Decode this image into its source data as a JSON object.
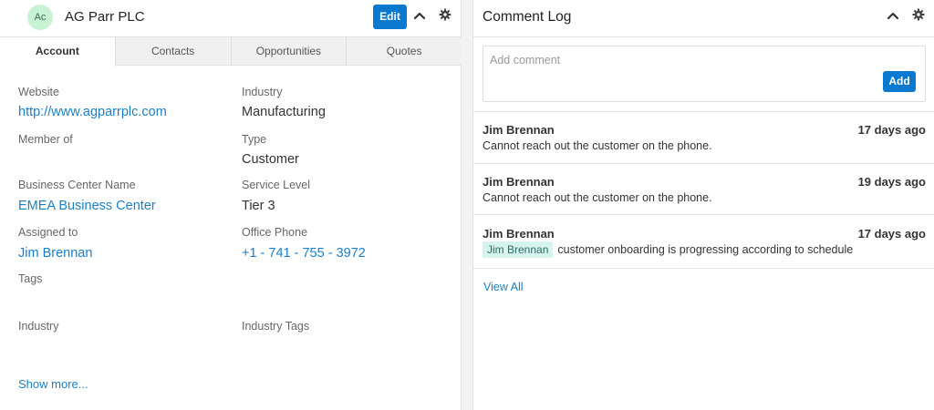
{
  "account": {
    "avatar_initials": "Ac",
    "title": "AG Parr PLC",
    "edit_label": "Edit"
  },
  "tabs": [
    {
      "label": "Account",
      "active": true
    },
    {
      "label": "Contacts",
      "active": false
    },
    {
      "label": "Opportunities",
      "active": false
    },
    {
      "label": "Quotes",
      "active": false
    }
  ],
  "fields": {
    "website": {
      "label": "Website",
      "value": "http://www.agparrplc.com"
    },
    "industry": {
      "label": "Industry",
      "value": "Manufacturing"
    },
    "member_of": {
      "label": "Member of",
      "value": ""
    },
    "type": {
      "label": "Type",
      "value": "Customer"
    },
    "business_center": {
      "label": "Business Center Name",
      "value": "EMEA Business Center"
    },
    "service_level": {
      "label": "Service Level",
      "value": "Tier 3"
    },
    "assigned_to": {
      "label": "Assigned to",
      "value": "Jim Brennan"
    },
    "office_phone": {
      "label": "Office Phone",
      "value": "+1 - 741 - 755 - 3972"
    },
    "tags": {
      "label": "Tags",
      "value": ""
    },
    "industry2": {
      "label": "Industry",
      "value": ""
    },
    "industry_tags": {
      "label": "Industry Tags",
      "value": ""
    }
  },
  "show_more": "Show more...",
  "comment_log": {
    "title": "Comment Log",
    "placeholder": "Add comment",
    "add_label": "Add",
    "entries": [
      {
        "author": "Jim Brennan",
        "time": "17 days ago",
        "text": "Cannot reach out the customer on the phone."
      },
      {
        "author": "Jim Brennan",
        "time": "19 days ago",
        "text": "Cannot reach out the customer on the phone."
      },
      {
        "author": "Jim Brennan",
        "time": "17 days ago",
        "mention": "Jim Brennan",
        "text": "customer onboarding is progressing according to schedule"
      }
    ],
    "view_all": "View All"
  },
  "colors": {
    "primary": "#0b79d0",
    "link": "#1a7fc9",
    "avatar_bg": "#c8f2d4",
    "mention_bg": "#d6f3ee"
  }
}
